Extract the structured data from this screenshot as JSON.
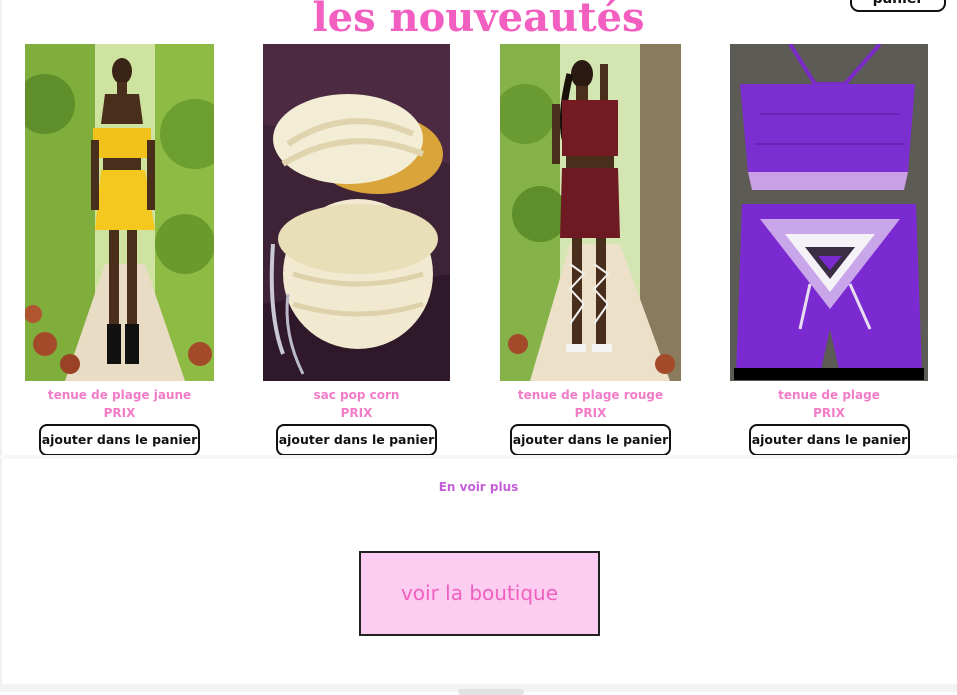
{
  "header": {
    "title": "les nouveautés",
    "cart_button_label": "panier"
  },
  "products": [
    {
      "name": "tenue de plage jaune",
      "price": "PRIX",
      "button_label": "ajouter dans le panier",
      "image": "photo-yellow-beach-outfit"
    },
    {
      "name": "sac pop corn",
      "price": "PRIX",
      "button_label": "ajouter dans le panier",
      "image": "photo-cream-crochet-bag"
    },
    {
      "name": "tenue de plage rouge",
      "price": "PRIX",
      "button_label": "ajouter dans le panier",
      "image": "photo-burgundy-beach-outfit"
    },
    {
      "name": "tenue de plage",
      "price": "PRIX",
      "button_label": "ajouter dans le panier",
      "image": "photo-purple-crochet-set"
    }
  ],
  "see_more_label": "En voir plus",
  "shop_button_label": "voir la boutique",
  "colors": {
    "title": "#f25fc0",
    "product_text": "#f27cc8",
    "see_more": "#c45fd9",
    "shop_button_bg": "#fccdf1",
    "shop_button_text": "#f05fbe"
  }
}
